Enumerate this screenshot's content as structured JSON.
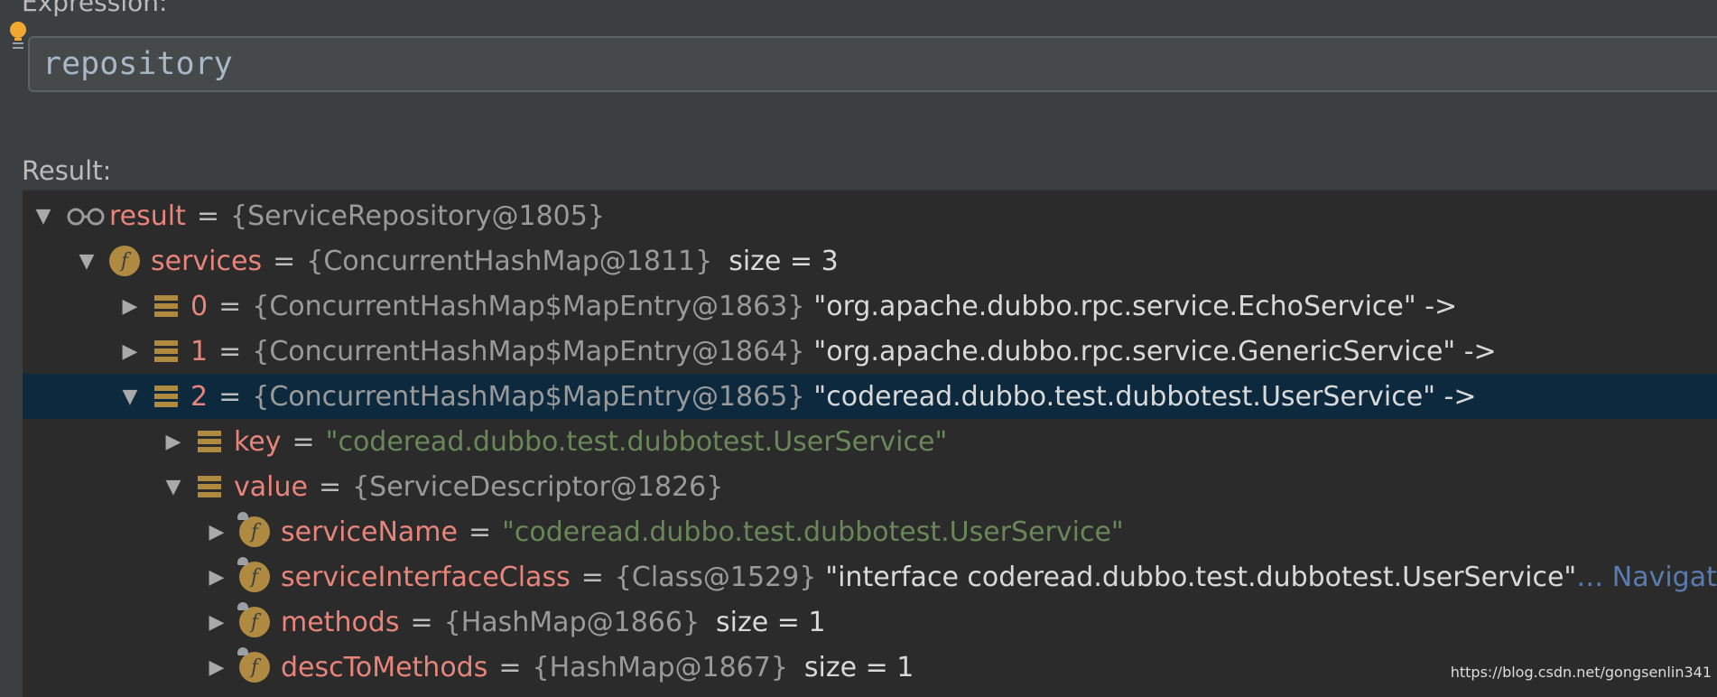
{
  "expression": {
    "label": "Expression:",
    "value": "repository"
  },
  "result_label": "Result:",
  "tree": [
    {
      "name": "result",
      "eq": "=",
      "obj": "{ServiceRepository@1805}"
    },
    {
      "name": "services",
      "eq": "=",
      "obj": "{ConcurrentHashMap@1811}",
      "extra": "size = 3"
    },
    {
      "name": "0",
      "eq": "=",
      "obj": "{ConcurrentHashMap$MapEntry@1863}",
      "text": "\"org.apache.dubbo.rpc.service.EchoService\" ->"
    },
    {
      "name": "1",
      "eq": "=",
      "obj": "{ConcurrentHashMap$MapEntry@1864}",
      "text": "\"org.apache.dubbo.rpc.service.GenericService\" ->"
    },
    {
      "name": "2",
      "eq": "=",
      "obj": "{ConcurrentHashMap$MapEntry@1865}",
      "text": "\"coderead.dubbo.test.dubbotest.UserService\" ->"
    },
    {
      "name": "key",
      "eq": "=",
      "str": "\"coderead.dubbo.test.dubbotest.UserService\""
    },
    {
      "name": "value",
      "eq": "=",
      "obj": "{ServiceDescriptor@1826}"
    },
    {
      "name": "serviceName",
      "eq": "=",
      "str": "\"coderead.dubbo.test.dubbotest.UserService\""
    },
    {
      "name": "serviceInterfaceClass",
      "eq": "=",
      "obj": "{Class@1529}",
      "text": "\"interface coderead.dubbo.test.dubbotest.UserService\"",
      "nav": "… Navigate"
    },
    {
      "name": "methods",
      "eq": "=",
      "obj": "{HashMap@1866}",
      "extra": "size = 1"
    },
    {
      "name": "descToMethods",
      "eq": "=",
      "obj": "{HashMap@1867}",
      "extra": "size = 1"
    }
  ],
  "watermark": "https://blog.csdn.net/gongsenlin341",
  "colors": {
    "background": "#3c3f41",
    "tree_background": "#2b2b2b",
    "selected_row": "#0d293e",
    "field_name": "#e8847a",
    "string_value": "#6a8759",
    "field_icon": "#b08a40",
    "navigate_link": "#5a7cb0"
  }
}
